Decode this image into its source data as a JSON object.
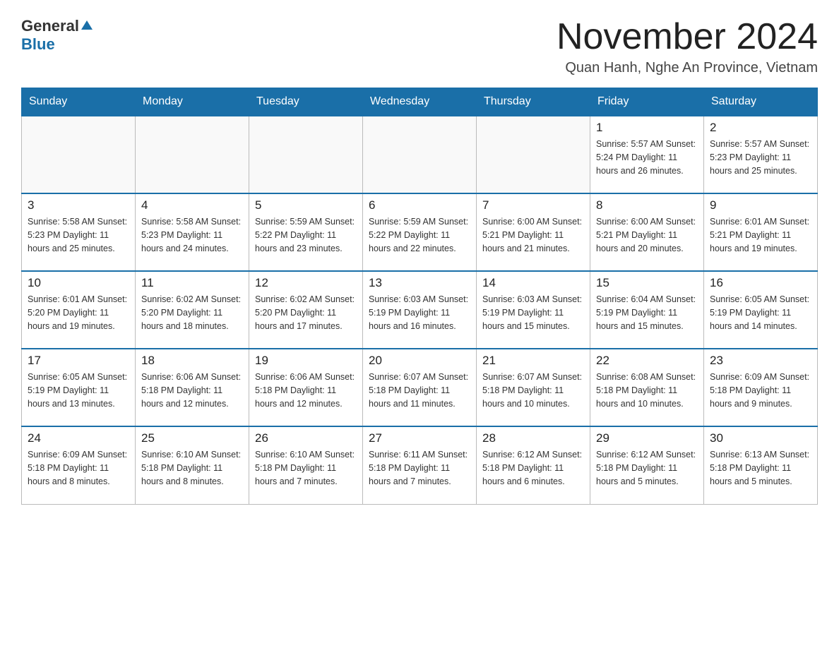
{
  "header": {
    "logo_general": "General",
    "logo_blue": "Blue",
    "month_title": "November 2024",
    "location": "Quan Hanh, Nghe An Province, Vietnam"
  },
  "days_of_week": [
    "Sunday",
    "Monday",
    "Tuesday",
    "Wednesday",
    "Thursday",
    "Friday",
    "Saturday"
  ],
  "weeks": [
    {
      "days": [
        {
          "number": "",
          "info": ""
        },
        {
          "number": "",
          "info": ""
        },
        {
          "number": "",
          "info": ""
        },
        {
          "number": "",
          "info": ""
        },
        {
          "number": "",
          "info": ""
        },
        {
          "number": "1",
          "info": "Sunrise: 5:57 AM\nSunset: 5:24 PM\nDaylight: 11 hours and 26 minutes."
        },
        {
          "number": "2",
          "info": "Sunrise: 5:57 AM\nSunset: 5:23 PM\nDaylight: 11 hours and 25 minutes."
        }
      ]
    },
    {
      "days": [
        {
          "number": "3",
          "info": "Sunrise: 5:58 AM\nSunset: 5:23 PM\nDaylight: 11 hours and 25 minutes."
        },
        {
          "number": "4",
          "info": "Sunrise: 5:58 AM\nSunset: 5:23 PM\nDaylight: 11 hours and 24 minutes."
        },
        {
          "number": "5",
          "info": "Sunrise: 5:59 AM\nSunset: 5:22 PM\nDaylight: 11 hours and 23 minutes."
        },
        {
          "number": "6",
          "info": "Sunrise: 5:59 AM\nSunset: 5:22 PM\nDaylight: 11 hours and 22 minutes."
        },
        {
          "number": "7",
          "info": "Sunrise: 6:00 AM\nSunset: 5:21 PM\nDaylight: 11 hours and 21 minutes."
        },
        {
          "number": "8",
          "info": "Sunrise: 6:00 AM\nSunset: 5:21 PM\nDaylight: 11 hours and 20 minutes."
        },
        {
          "number": "9",
          "info": "Sunrise: 6:01 AM\nSunset: 5:21 PM\nDaylight: 11 hours and 19 minutes."
        }
      ]
    },
    {
      "days": [
        {
          "number": "10",
          "info": "Sunrise: 6:01 AM\nSunset: 5:20 PM\nDaylight: 11 hours and 19 minutes."
        },
        {
          "number": "11",
          "info": "Sunrise: 6:02 AM\nSunset: 5:20 PM\nDaylight: 11 hours and 18 minutes."
        },
        {
          "number": "12",
          "info": "Sunrise: 6:02 AM\nSunset: 5:20 PM\nDaylight: 11 hours and 17 minutes."
        },
        {
          "number": "13",
          "info": "Sunrise: 6:03 AM\nSunset: 5:19 PM\nDaylight: 11 hours and 16 minutes."
        },
        {
          "number": "14",
          "info": "Sunrise: 6:03 AM\nSunset: 5:19 PM\nDaylight: 11 hours and 15 minutes."
        },
        {
          "number": "15",
          "info": "Sunrise: 6:04 AM\nSunset: 5:19 PM\nDaylight: 11 hours and 15 minutes."
        },
        {
          "number": "16",
          "info": "Sunrise: 6:05 AM\nSunset: 5:19 PM\nDaylight: 11 hours and 14 minutes."
        }
      ]
    },
    {
      "days": [
        {
          "number": "17",
          "info": "Sunrise: 6:05 AM\nSunset: 5:19 PM\nDaylight: 11 hours and 13 minutes."
        },
        {
          "number": "18",
          "info": "Sunrise: 6:06 AM\nSunset: 5:18 PM\nDaylight: 11 hours and 12 minutes."
        },
        {
          "number": "19",
          "info": "Sunrise: 6:06 AM\nSunset: 5:18 PM\nDaylight: 11 hours and 12 minutes."
        },
        {
          "number": "20",
          "info": "Sunrise: 6:07 AM\nSunset: 5:18 PM\nDaylight: 11 hours and 11 minutes."
        },
        {
          "number": "21",
          "info": "Sunrise: 6:07 AM\nSunset: 5:18 PM\nDaylight: 11 hours and 10 minutes."
        },
        {
          "number": "22",
          "info": "Sunrise: 6:08 AM\nSunset: 5:18 PM\nDaylight: 11 hours and 10 minutes."
        },
        {
          "number": "23",
          "info": "Sunrise: 6:09 AM\nSunset: 5:18 PM\nDaylight: 11 hours and 9 minutes."
        }
      ]
    },
    {
      "days": [
        {
          "number": "24",
          "info": "Sunrise: 6:09 AM\nSunset: 5:18 PM\nDaylight: 11 hours and 8 minutes."
        },
        {
          "number": "25",
          "info": "Sunrise: 6:10 AM\nSunset: 5:18 PM\nDaylight: 11 hours and 8 minutes."
        },
        {
          "number": "26",
          "info": "Sunrise: 6:10 AM\nSunset: 5:18 PM\nDaylight: 11 hours and 7 minutes."
        },
        {
          "number": "27",
          "info": "Sunrise: 6:11 AM\nSunset: 5:18 PM\nDaylight: 11 hours and 7 minutes."
        },
        {
          "number": "28",
          "info": "Sunrise: 6:12 AM\nSunset: 5:18 PM\nDaylight: 11 hours and 6 minutes."
        },
        {
          "number": "29",
          "info": "Sunrise: 6:12 AM\nSunset: 5:18 PM\nDaylight: 11 hours and 5 minutes."
        },
        {
          "number": "30",
          "info": "Sunrise: 6:13 AM\nSunset: 5:18 PM\nDaylight: 11 hours and 5 minutes."
        }
      ]
    }
  ]
}
